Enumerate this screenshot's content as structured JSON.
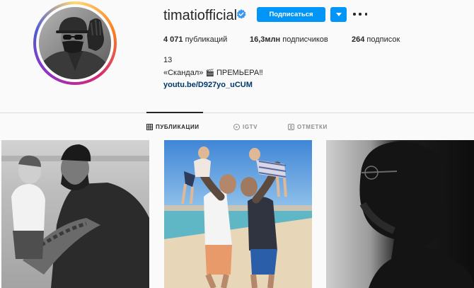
{
  "profile": {
    "username": "timatiofficial",
    "verified": true,
    "follow_label": "Подписаться",
    "stats": {
      "posts_value": "4 071",
      "posts_label": "публикаций",
      "followers_value": "16,3млн",
      "followers_label": "подписчиков",
      "following_value": "264",
      "following_label": "подписок"
    },
    "bio": {
      "line1": "13",
      "line2_before": "«Скандал»",
      "line2_emoji": "🎬",
      "line2_after": "ПРЕМЬЕРА‼",
      "link": "youtu.be/D927yo_uCUM"
    }
  },
  "tabs": [
    {
      "label": "ПУБЛИКАЦИИ",
      "icon": "grid-icon",
      "active": true
    },
    {
      "label": "IGTV",
      "icon": "igtv-icon",
      "active": false
    },
    {
      "label": "ОТМЕТКИ",
      "icon": "tagged-icon",
      "active": false
    }
  ],
  "colors": {
    "accent": "#0095f6",
    "link": "#00376b",
    "text": "#262626",
    "muted": "#8e8e8e",
    "background": "#fafafa"
  }
}
